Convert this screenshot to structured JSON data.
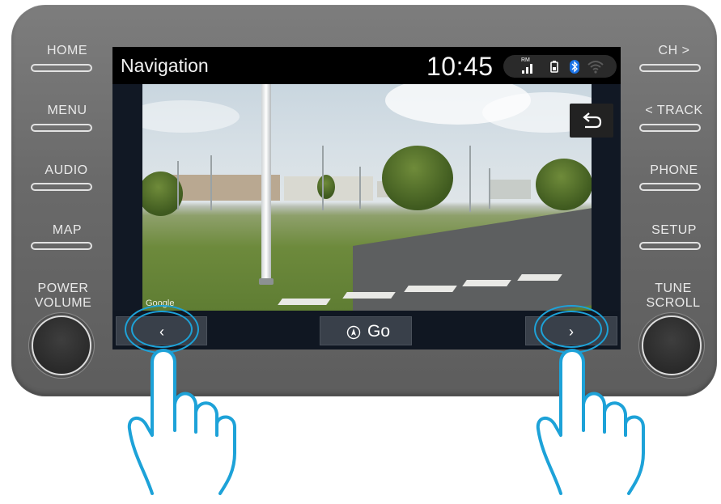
{
  "hardware_left": {
    "home": "HOME",
    "menu": "MENU",
    "audio": "AUDIO",
    "map": "MAP",
    "power_volume": "POWER\nVOLUME"
  },
  "hardware_right": {
    "ch": "CH >",
    "track": "< TRACK",
    "phone": "PHONE",
    "setup": "SETUP",
    "tune_scroll": "TUNE\nSCROLL"
  },
  "status": {
    "title": "Navigation",
    "time": "10:45",
    "signal_label": "RM"
  },
  "streetview": {
    "attribution": "Google"
  },
  "toolbar": {
    "prev_icon": "‹",
    "next_icon": "›",
    "go_label": "Go"
  },
  "colors": {
    "highlight": "#1da2d8",
    "bluetooth": "#1a73e8"
  }
}
